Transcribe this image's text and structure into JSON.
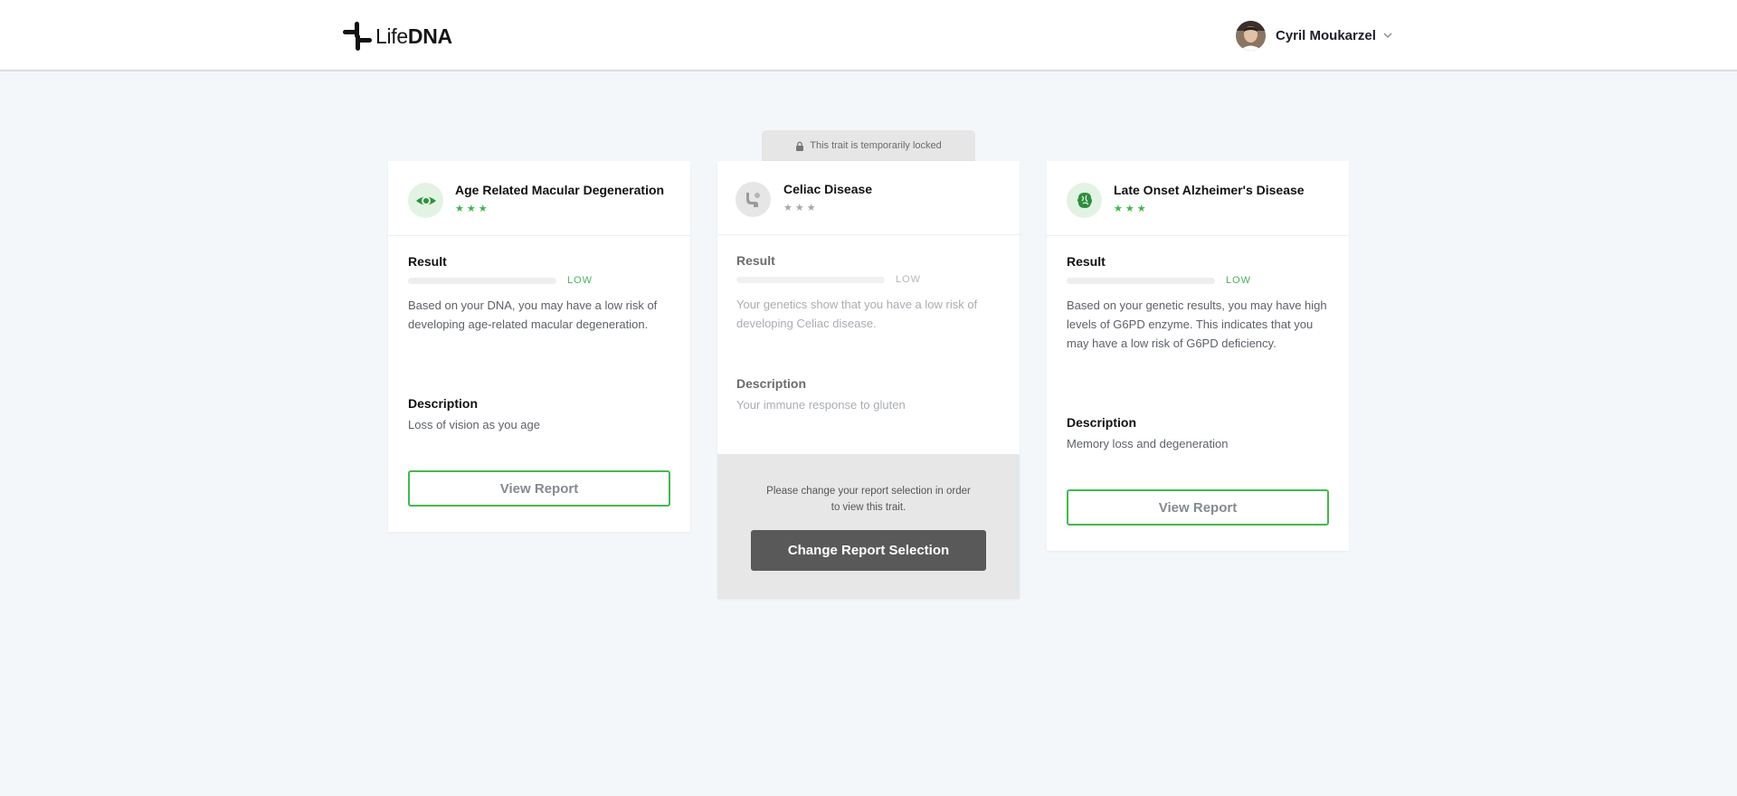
{
  "header": {
    "logo_light": "Life",
    "logo_bold": "DNA",
    "user_name": "Cyril Moukarzel"
  },
  "locked_notice": "This trait is temporarily locked",
  "labels": {
    "result": "Result",
    "description": "Description"
  },
  "cards": [
    {
      "title": "Age Related Macular Degeneration",
      "icon": "eye-icon",
      "stars": "★★★",
      "level": "LOW",
      "result_text": "Based on your DNA, you may have a low risk of developing age-related macular degeneration.",
      "description": "Loss of vision as you age",
      "button": "View Report",
      "locked": false
    },
    {
      "title": "Celiac Disease",
      "icon": "digestion-icon",
      "stars": "★★★",
      "level": "LOW",
      "result_text": "Your genetics show that you have a low risk of developing Celiac disease.",
      "description": "Your immune response to gluten",
      "locked": true,
      "lock_message": "Please change your report selection in order to view this trait.",
      "lock_button": "Change Report Selection"
    },
    {
      "title": "Late Onset Alzheimer's Disease",
      "icon": "brain-icon",
      "stars": "★★★",
      "level": "LOW",
      "result_text": "Based on your genetic results, you may have high levels of G6PD enzyme. This indicates that you may have a low risk of G6PD deficiency.",
      "description": "Memory loss and degeneration",
      "button": "View Report",
      "locked": false
    }
  ],
  "colors": {
    "accent_green": "#46b84f",
    "page_background": "#f4f7fa",
    "locked_button": "#595959"
  }
}
